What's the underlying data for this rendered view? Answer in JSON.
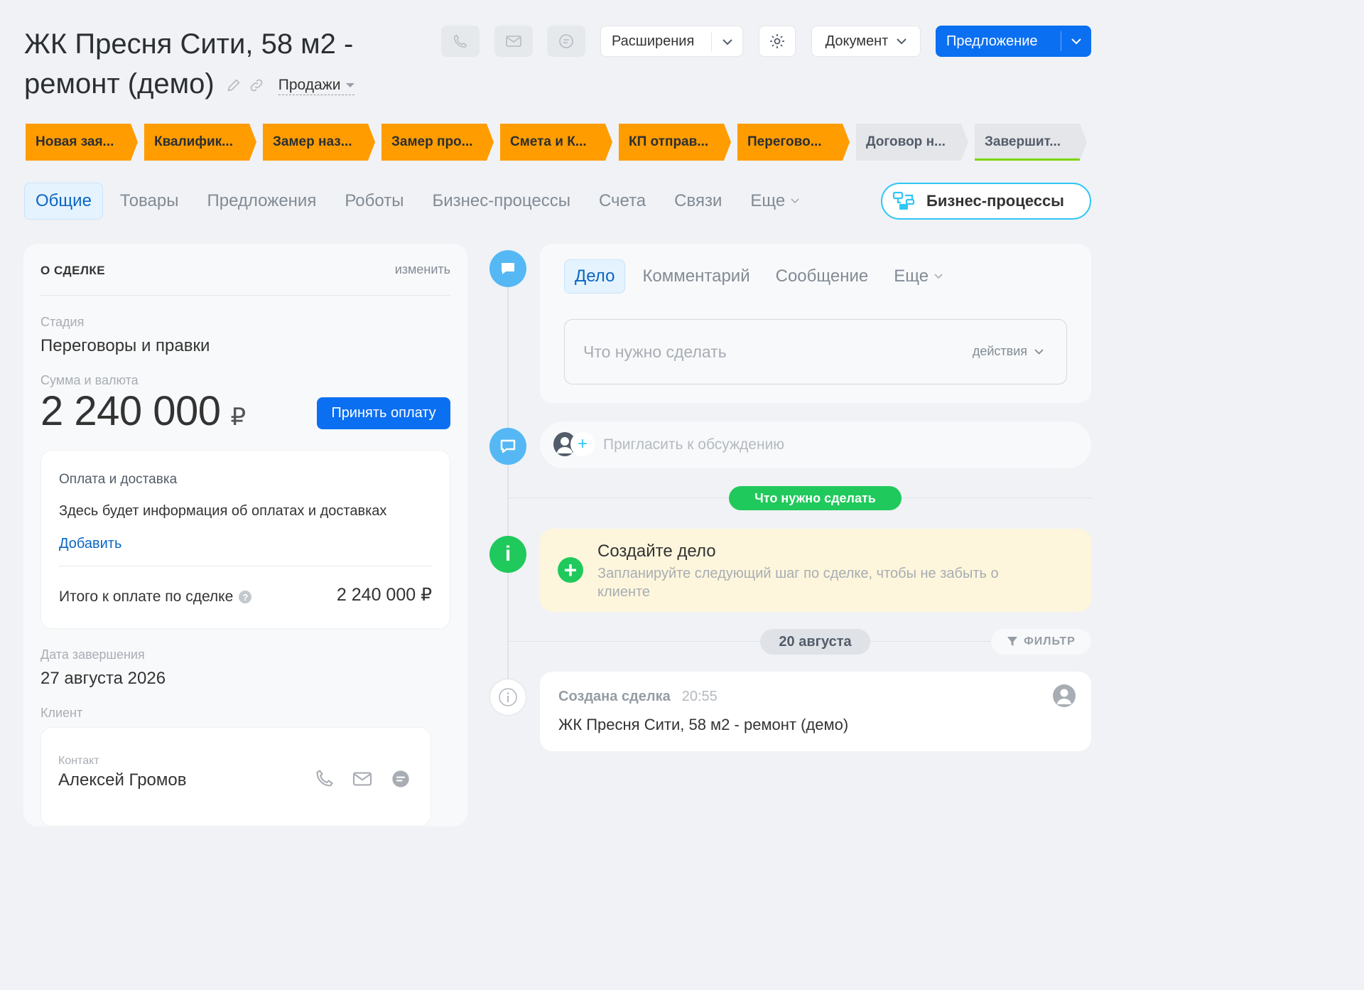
{
  "header": {
    "title": "ЖК Пресня Сити, 58 м2 - ремонт (демо)",
    "funnel": "Продажи",
    "extensions_label": "Расширения",
    "document_label": "Документ",
    "offer_label": "Предложение"
  },
  "stages": [
    {
      "label": "Новая зая...",
      "state": "active"
    },
    {
      "label": "Квалифик...",
      "state": "active"
    },
    {
      "label": "Замер наз...",
      "state": "active"
    },
    {
      "label": "Замер про...",
      "state": "active"
    },
    {
      "label": "Смета и К...",
      "state": "active"
    },
    {
      "label": "КП отправ...",
      "state": "active"
    },
    {
      "label": "Перегово...",
      "state": "active"
    },
    {
      "label": "Договор н...",
      "state": "inactive"
    },
    {
      "label": "Завершит...",
      "state": "inactive"
    }
  ],
  "tabs": [
    {
      "label": "Общие",
      "selected": true
    },
    {
      "label": "Товары"
    },
    {
      "label": "Предложения"
    },
    {
      "label": "Роботы"
    },
    {
      "label": "Бизнес-процессы"
    },
    {
      "label": "Счета"
    },
    {
      "label": "Связи"
    },
    {
      "label": "Еще"
    }
  ],
  "bp_button_label": "Бизнес-процессы",
  "deal": {
    "section_title": "О СДЕЛКЕ",
    "edit_label": "изменить",
    "stage_label": "Стадия",
    "stage_value": "Переговоры и правки",
    "amount_label": "Сумма и валюта",
    "amount_value": "2 240 000",
    "currency": "₽",
    "accept_payment_label": "Принять оплату",
    "payment": {
      "title": "Оплата и доставка",
      "info": "Здесь будет информация об оплатах и доставках",
      "add_label": "Добавить",
      "total_label": "Итого к оплате по сделке",
      "total_value": "2 240 000 ₽"
    },
    "close_date_label": "Дата завершения",
    "close_date_value": "27 августа 2026",
    "client_label": "Клиент",
    "contact_label": "Контакт",
    "contact_name": "Алексей Громов"
  },
  "timeline": {
    "editor_tabs": [
      {
        "label": "Дело",
        "selected": true
      },
      {
        "label": "Комментарий"
      },
      {
        "label": "Сообщение"
      },
      {
        "label": "Еще"
      }
    ],
    "todo_placeholder": "Что нужно сделать",
    "actions_label": "действия",
    "invite_placeholder": "Пригласить к обсуждению",
    "todo_section_label": "Что нужно сделать",
    "create_task_title": "Создайте дело",
    "create_task_hint": "Запланируйте следующий шаг по сделке, чтобы не забыть о клиенте",
    "date_label": "20 августа",
    "filter_label": "ФИЛЬТР",
    "event_title": "Создана сделка",
    "event_time": "20:55",
    "event_text": "ЖК Пресня Сити, 58 м2 - ремонт (демо)"
  },
  "colors": {
    "stage_active": "#ff9c00",
    "stage_inactive": "#e4e6e9",
    "primary_blue": "#0b6ff2",
    "green": "#20c95b",
    "timeline_blue": "#55b8f5",
    "task_bg": "#fdf6dc"
  }
}
